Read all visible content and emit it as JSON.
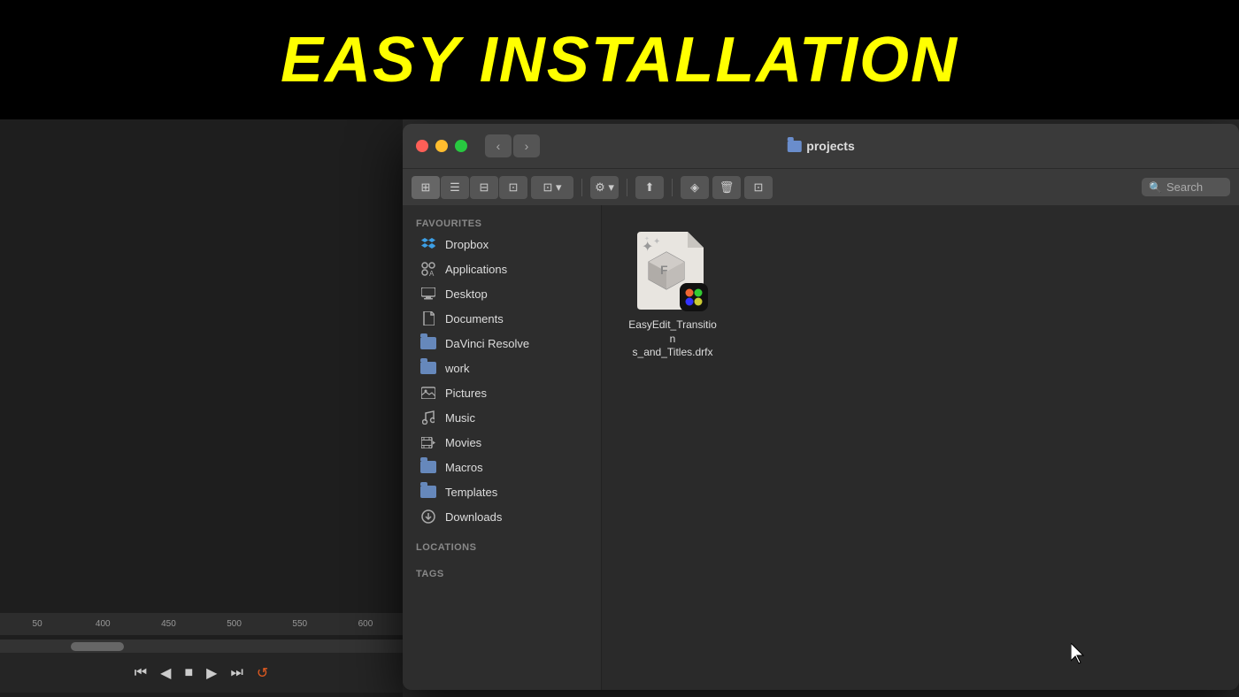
{
  "header": {
    "title": "EASY INSTALLATION"
  },
  "finder": {
    "window_title": "projects",
    "search_placeholder": "Search",
    "toolbar": {
      "nav_back": "‹",
      "nav_forward": "›",
      "view_icons": "⊞",
      "view_list": "≡",
      "view_columns": "⊟",
      "view_gallery": "⊡",
      "view_options": "⊡",
      "settings_icon": "⚙",
      "share_icon": "↑",
      "tag_icon": "◈",
      "trash_icon": "🗑",
      "new_folder_icon": "⊡"
    },
    "sidebar": {
      "sections": [
        {
          "label": "Favourites",
          "items": [
            {
              "icon": "dropbox",
              "label": "Dropbox"
            },
            {
              "icon": "applications",
              "label": "Applications"
            },
            {
              "icon": "desktop",
              "label": "Desktop"
            },
            {
              "icon": "documents",
              "label": "Documents"
            },
            {
              "icon": "folder",
              "label": "DaVinci Resolve"
            },
            {
              "icon": "folder",
              "label": "work"
            },
            {
              "icon": "pictures",
              "label": "Pictures"
            },
            {
              "icon": "music",
              "label": "Music"
            },
            {
              "icon": "movies",
              "label": "Movies"
            },
            {
              "icon": "folder",
              "label": "Macros"
            },
            {
              "icon": "folder",
              "label": "Templates"
            },
            {
              "icon": "downloads",
              "label": "Downloads"
            }
          ]
        },
        {
          "label": "Locations",
          "items": []
        },
        {
          "label": "Tags",
          "items": []
        }
      ]
    },
    "content": {
      "files": [
        {
          "name": "EasyEdit_Transitions_and_Titles.drfx",
          "display_name": "EasyEdit_Transition\ns_and_Titles.drfx",
          "type": "drfx"
        }
      ]
    }
  },
  "timeline": {
    "markers": [
      "50",
      "400",
      "450",
      "500",
      "550",
      "600"
    ],
    "transport": {
      "skip_back": "⏮",
      "prev": "◀",
      "stop": "■",
      "play": "▶",
      "skip_forward": "⏭",
      "loop": "↺"
    }
  }
}
